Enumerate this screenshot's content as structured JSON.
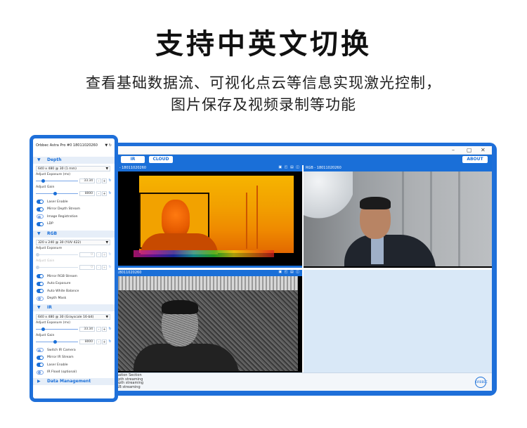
{
  "headline": "支持中英文切换",
  "subline1": "查看基础数据流、可视化点云等信息实现激光控制，",
  "subline2": "图片保存及视频录制等功能",
  "colors": {
    "accent": "#1a6fd8",
    "frame": "#1e6fd9"
  },
  "window": {
    "controls": [
      "–",
      "▢",
      "✕"
    ],
    "tabs": {
      "ir": "IR",
      "cloud": "CLOUD"
    },
    "about": "ABOUT",
    "panels": {
      "depth_title": "th - 18011020260",
      "rgb_title": "RGB - 18011020260",
      "ir_title": "- 18011020260",
      "panel_icons": "▣ ◰ ▤ ◫"
    },
    "log_lines": [
      "rmation Section",
      "depth streaming",
      "Depth streaming",
      "RGB streaming",
      "IR streaming"
    ],
    "logo_text": "ORBBEC"
  },
  "sidebar": {
    "device": "Orbbec Astra Pro #0 18011020260",
    "device_icons": "▼ ↻",
    "depth": {
      "title": "Depth",
      "mode": "640 x 480 @ 30 (1 mm)",
      "exposure_label": "Adjust Exposure (ms)",
      "exposure_value": "33.34",
      "exposure_level": 0.15,
      "gain_label": "Adjust Gain",
      "gain_value": "8000",
      "gain_level": 0.45,
      "toggles": [
        {
          "label": "Laser Enable",
          "on": true
        },
        {
          "label": "Mirror Depth Stream",
          "on": true
        },
        {
          "label": "Image Registration",
          "on": false
        },
        {
          "label": "LDP",
          "on": true
        }
      ]
    },
    "rgb": {
      "title": "RGB",
      "mode": "320 x 240 @ 30 (YUV 422)",
      "exposure_label": "Adjust Exposure",
      "exposure_value": "0",
      "gain_label": "Adjust Gain",
      "gain_value": "0",
      "toggles": [
        {
          "label": "Mirror RGB Stream",
          "on": true
        },
        {
          "label": "Auto Exposure",
          "on": true
        },
        {
          "label": "Auto White Balance",
          "on": true
        },
        {
          "label": "Depth Mask",
          "on": false
        }
      ]
    },
    "ir": {
      "title": "IR",
      "mode": "640 x 480 @ 30 (Grayscale 16-bit)",
      "exposure_label": "Adjust Exposure (ms)",
      "exposure_value": "33.34",
      "exposure_level": 0.15,
      "gain_label": "Adjust Gain",
      "gain_value": "8000",
      "gain_level": 0.45,
      "toggles": [
        {
          "label": "Switch IR Camera",
          "on": false
        },
        {
          "label": "Mirror IR Stream",
          "on": true
        },
        {
          "label": "Laser Enable",
          "on": true
        },
        {
          "label": "IR Flood (optional)",
          "on": false
        }
      ]
    },
    "data_management": "Data Management",
    "btn_minus": "-",
    "btn_plus": "+",
    "btn_reset": "↻",
    "arrow_down": "▼",
    "arrow_right": "▶"
  }
}
